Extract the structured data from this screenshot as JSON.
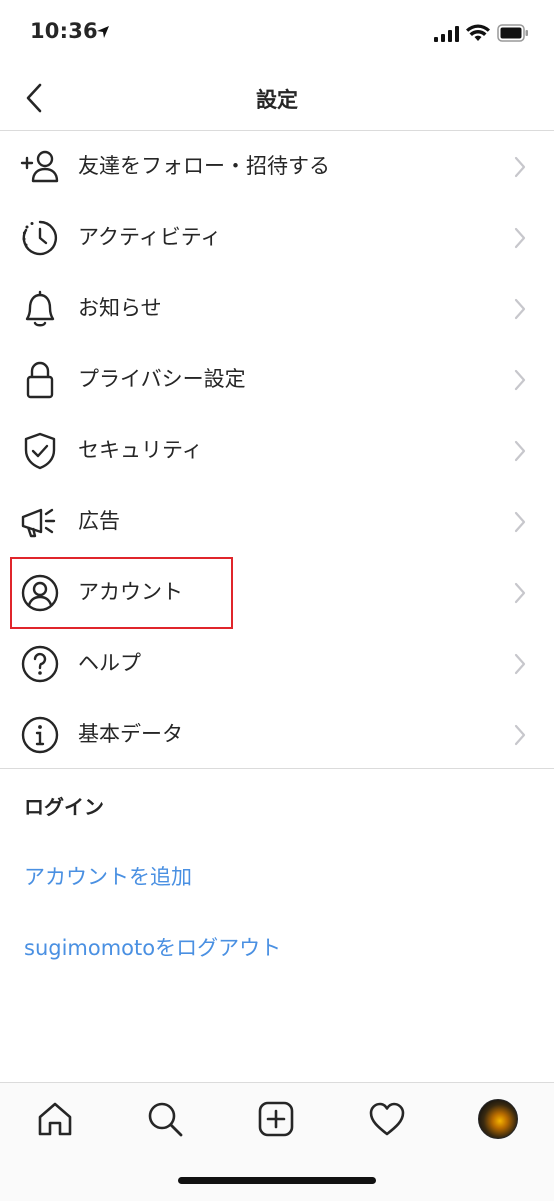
{
  "status_bar": {
    "time": "10:36"
  },
  "header": {
    "title": "設定"
  },
  "menu_items": [
    {
      "label": "友達をフォロー・招待する",
      "icon": "add-person-icon"
    },
    {
      "label": "アクティビティ",
      "icon": "activity-clock-icon"
    },
    {
      "label": "お知らせ",
      "icon": "bell-icon"
    },
    {
      "label": "プライバシー設定",
      "icon": "lock-icon"
    },
    {
      "label": "セキュリティ",
      "icon": "shield-check-icon"
    },
    {
      "label": "広告",
      "icon": "megaphone-icon"
    },
    {
      "label": "アカウント",
      "icon": "account-circle-icon"
    },
    {
      "label": "ヘルプ",
      "icon": "help-circle-icon"
    },
    {
      "label": "基本データ",
      "icon": "info-circle-icon"
    }
  ],
  "login_section": {
    "heading": "ログイン",
    "add_account": "アカウントを追加",
    "logout": "sugimomotoをログアウト"
  },
  "tab_bar": [
    "home-icon",
    "search-icon",
    "new-post-icon",
    "heart-icon",
    "profile-avatar"
  ],
  "colors": {
    "link": "#4a90e2",
    "highlight": "#e0252b",
    "divider": "#dbdbdb"
  }
}
